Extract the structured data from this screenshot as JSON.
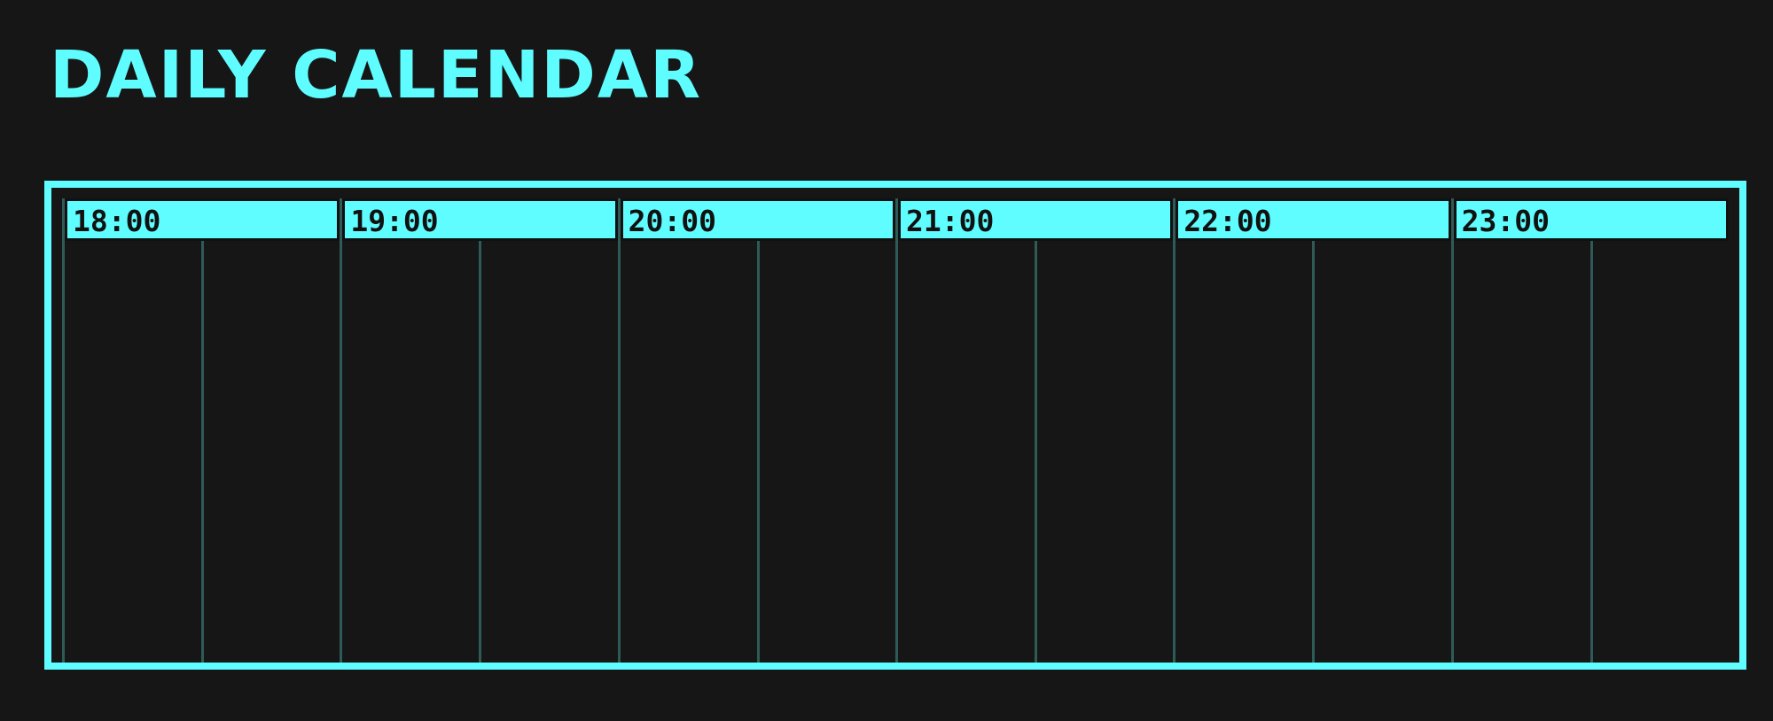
{
  "title": "DAILY CALENDAR",
  "colors": {
    "accent": "#5ffdff",
    "background": "#161616",
    "divider": "#2e5b57",
    "header_text": "#111111"
  },
  "hours": [
    {
      "label": "18:00"
    },
    {
      "label": "19:00"
    },
    {
      "label": "20:00"
    },
    {
      "label": "21:00"
    },
    {
      "label": "22:00"
    },
    {
      "label": "23:00"
    }
  ]
}
